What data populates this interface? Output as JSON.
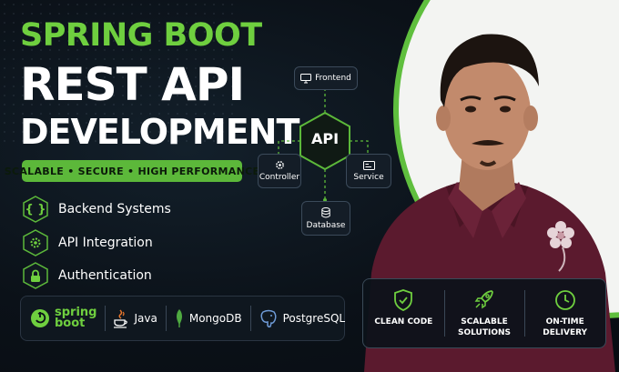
{
  "headline": {
    "line1": "SPRING BOOT",
    "line2": "REST API",
    "line3": "DEVELOPMENT"
  },
  "tagline": "SCALABLE • SECURE • HIGH PERFORMANCE",
  "features": [
    {
      "label": "Backend Systems",
      "icon": "curly-braces-icon"
    },
    {
      "label": "API Integration",
      "icon": "gear-icon"
    },
    {
      "label": "Authentication",
      "icon": "lock-icon"
    }
  ],
  "diagram": {
    "center": "API",
    "nodes": {
      "frontend": "Frontend",
      "controller": "Controller",
      "service": "Service",
      "database": "Database"
    }
  },
  "tech": {
    "spring_line1": "spring",
    "spring_line2": "boot",
    "java": "Java",
    "mongodb": "MongoDB",
    "postgresql": "PostgreSQL"
  },
  "benefits": [
    {
      "label": "CLEAN CODE",
      "icon": "shield-check-icon"
    },
    {
      "label": "SCALABLE\nSOLUTIONS",
      "icon": "rocket-icon"
    },
    {
      "label": "ON-TIME\nDELIVERY",
      "icon": "clock-icon"
    }
  ],
  "colors": {
    "accent": "#6fcf3f",
    "background": "#0b1118",
    "text": "#ffffff"
  }
}
